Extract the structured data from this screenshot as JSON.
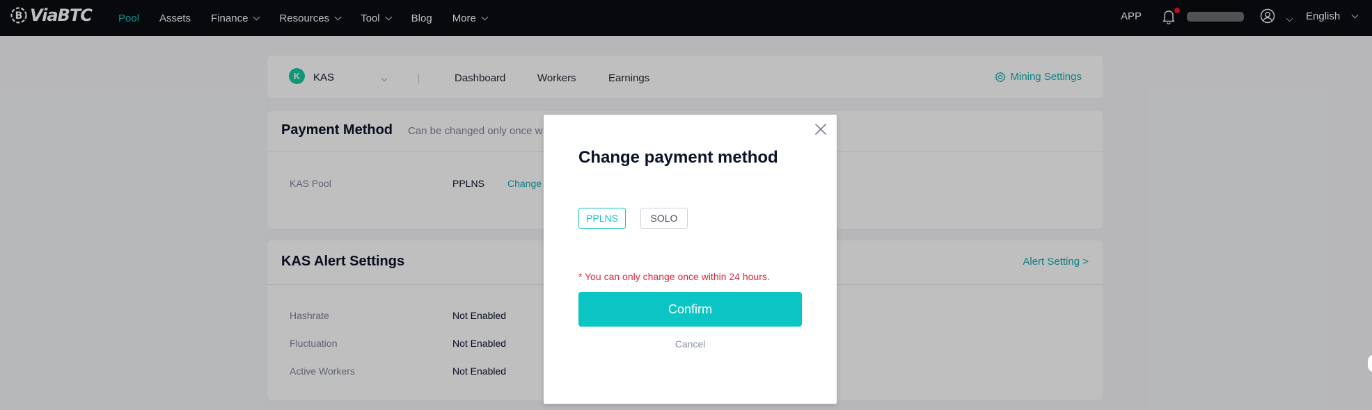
{
  "nav": {
    "brand": "ViaBTC",
    "items": [
      {
        "label": "Pool",
        "active": true,
        "dropdown": false
      },
      {
        "label": "Assets",
        "active": false,
        "dropdown": false
      },
      {
        "label": "Finance",
        "active": false,
        "dropdown": true
      },
      {
        "label": "Resources",
        "active": false,
        "dropdown": true
      },
      {
        "label": "Tool",
        "active": false,
        "dropdown": true
      },
      {
        "label": "Blog",
        "active": false,
        "dropdown": false
      },
      {
        "label": "More",
        "active": false,
        "dropdown": true
      }
    ],
    "app_label": "APP",
    "language": "English",
    "has_notification": true
  },
  "subnav": {
    "coin": "KAS",
    "coin_icon_glyph": "K",
    "tabs": [
      "Dashboard",
      "Workers",
      "Earnings"
    ],
    "mining_settings": "Mining Settings"
  },
  "payment": {
    "title": "Payment Method",
    "subtitle": "Can be changed only once w",
    "row_label": "KAS Pool",
    "row_value": "PPLNS",
    "change_link": "Change"
  },
  "alerts": {
    "title": "KAS Alert Settings",
    "link": "Alert Setting >",
    "rows": [
      {
        "label": "Hashrate",
        "value": "Not Enabled"
      },
      {
        "label": "Fluctuation",
        "value": "Not Enabled"
      },
      {
        "label": "Active Workers",
        "value": "Not Enabled"
      }
    ]
  },
  "modal": {
    "title": "Change payment method",
    "options": [
      {
        "label": "PPLNS",
        "selected": true
      },
      {
        "label": "SOLO",
        "selected": false
      }
    ],
    "note": "* You can only change once within 24 hours.",
    "confirm": "Confirm",
    "cancel": "Cancel"
  },
  "colors": {
    "accent": "#11c3c1",
    "link": "#13a9ad",
    "warning": "#e0263e",
    "nav_bg": "#0a0c11",
    "coin": "#19c8a1"
  }
}
